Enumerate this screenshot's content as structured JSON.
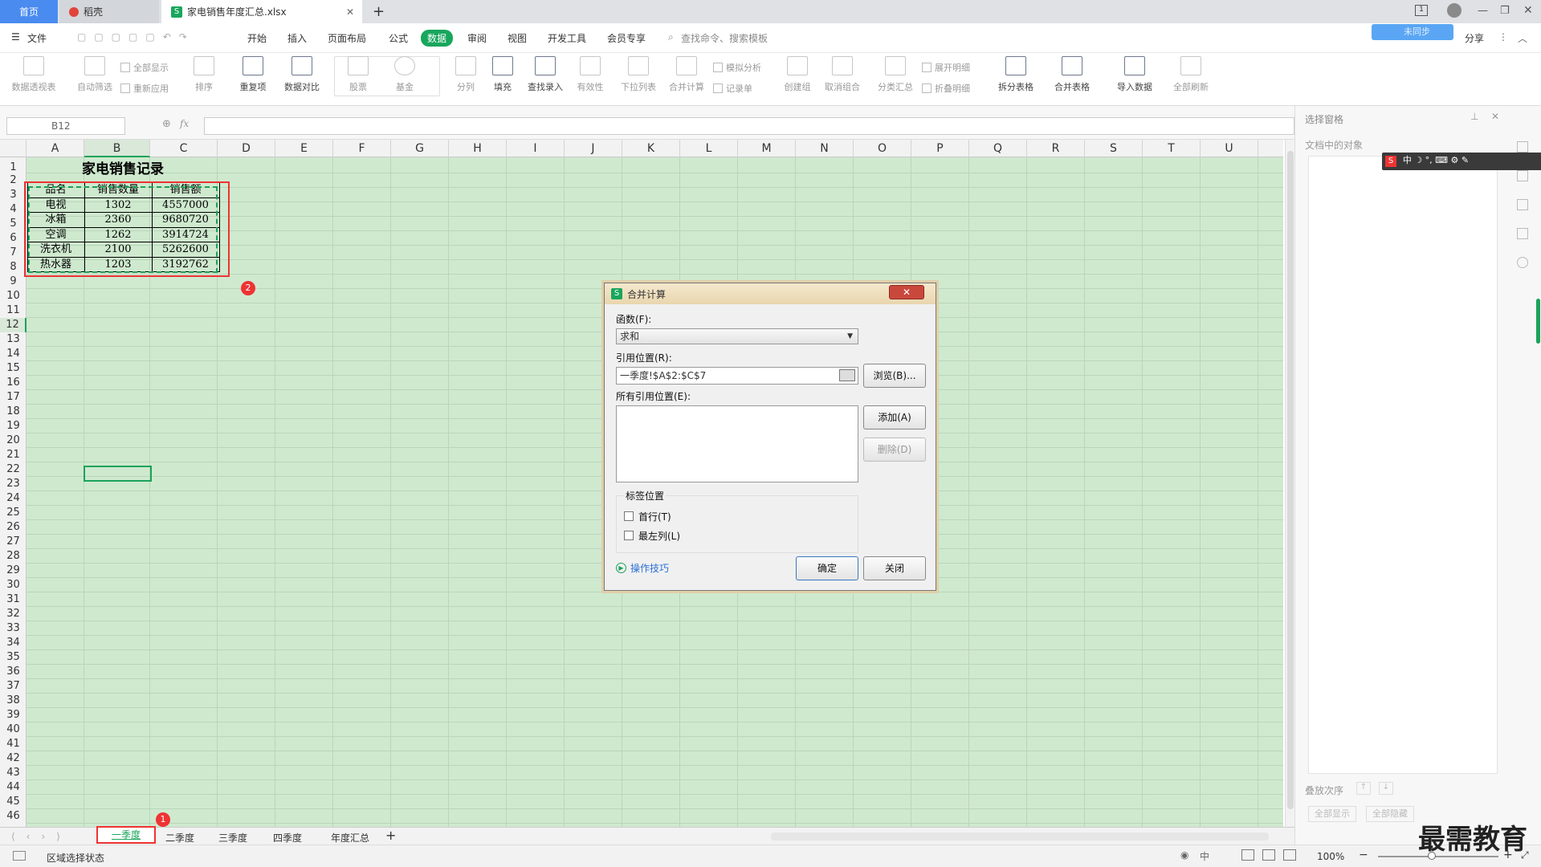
{
  "tabs": {
    "home": "首页",
    "doc": "稻壳",
    "active": "家电销售年度汇总.xlsx",
    "new": "+"
  },
  "menu": {
    "file": "文件",
    "items": [
      "开始",
      "插入",
      "页面布局",
      "公式",
      "数据",
      "审阅",
      "视图",
      "开发工具",
      "会员专享"
    ],
    "search": "查找命令、搜索模板",
    "share": "分享",
    "sync": "未同步"
  },
  "ribbon": {
    "pivot": "数据透视表",
    "autofilter": "自动筛选",
    "showall": "全部显示",
    "reapply": "重新应用",
    "sort": "排序",
    "dup": "重复项",
    "compare": "数据对比",
    "stock": "股票",
    "fund": "基金",
    "split": "分列",
    "fill": "填充",
    "lookup": "查找录入",
    "valid": "有效性",
    "dropdown": "下拉列表",
    "consolidate": "合并计算",
    "simulate": "模拟分析",
    "record": "记录单",
    "create_group": "创建组",
    "ungroup": "取消组合",
    "subtotal": "分类汇总",
    "expand": "展开明细",
    "collapse": "折叠明细",
    "split_table": "拆分表格",
    "merge_table": "合并表格",
    "import": "导入数据",
    "refresh": "全部刷新"
  },
  "formula": {
    "namebox": "B12",
    "fx": "fx"
  },
  "columns": [
    "A",
    "B",
    "C",
    "D",
    "E",
    "F",
    "G",
    "H",
    "I",
    "J",
    "K",
    "L",
    "M",
    "N",
    "O",
    "P",
    "Q",
    "R",
    "S",
    "T",
    "U"
  ],
  "rows": [
    "1",
    "2",
    "3",
    "4",
    "5",
    "6",
    "7",
    "8",
    "9",
    "10",
    "11",
    "12",
    "13",
    "14",
    "15",
    "16",
    "17",
    "18",
    "19",
    "20",
    "21",
    "22",
    "23",
    "24",
    "25",
    "26",
    "27",
    "28",
    "29",
    "30",
    "31",
    "32",
    "33",
    "34",
    "35",
    "36",
    "37",
    "38",
    "39",
    "40",
    "41",
    "42",
    "43",
    "44",
    "45",
    "46"
  ],
  "sheet": {
    "title": "家电销售记录",
    "headers": [
      "品名",
      "销售数量",
      "销售额"
    ],
    "data": [
      [
        "电视",
        "1302",
        "4557000"
      ],
      [
        "冰箱",
        "2360",
        "9680720"
      ],
      [
        "空调",
        "1262",
        "3914724"
      ],
      [
        "洗衣机",
        "2100",
        "5262600"
      ],
      [
        "热水器",
        "1203",
        "3192762"
      ]
    ]
  },
  "badges": {
    "one": "1",
    "two": "2"
  },
  "sheettabs": [
    "一季度",
    "二季度",
    "三季度",
    "四季度",
    "年度汇总"
  ],
  "status": {
    "mode": "区域选择状态",
    "zoom": "100%"
  },
  "rightpanel": {
    "title": "选择窗格",
    "objects": "文档中的对象",
    "order": "叠放次序",
    "showall": "全部显示",
    "hideall": "全部隐藏"
  },
  "dialog": {
    "title": "合并计算",
    "func_label": "函数(F):",
    "func_value": "求和",
    "ref_label": "引用位置(R):",
    "ref_value": "一季度!$A$2:$C$7",
    "browse": "浏览(B)...",
    "all_refs_label": "所有引用位置(E):",
    "add": "添加(A)",
    "delete": "删除(D)",
    "label_pos": "标签位置",
    "first_row": "首行(T)",
    "left_col": "最左列(L)",
    "tips": "操作技巧",
    "ok": "确定",
    "close": "关闭"
  },
  "watermark": "最需教育"
}
